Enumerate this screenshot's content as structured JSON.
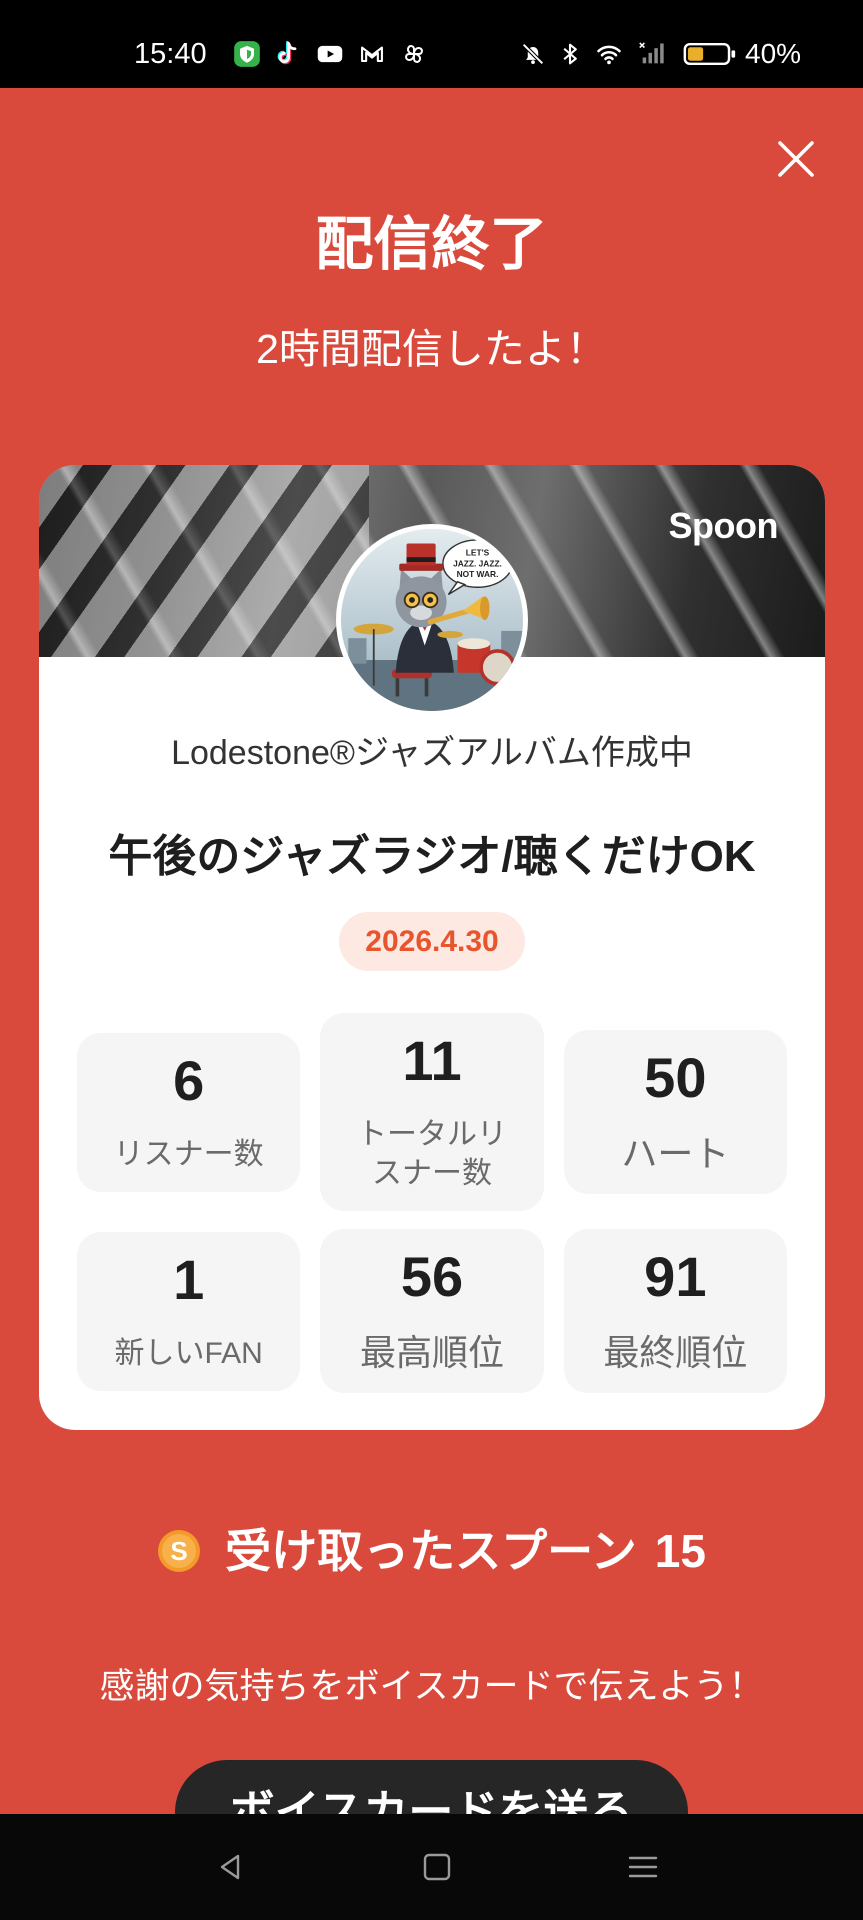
{
  "theme": {
    "background": "#DA4A3C",
    "card": "#FFFFFF",
    "stat_box": "#F5F5F5",
    "date_text": "#E8552D",
    "date_badge": "#FDE8E2",
    "button": "#262626",
    "coin": "#F39A2B",
    "battery": "#E8B02A"
  },
  "status_bar": {
    "time": "15:40",
    "notification_icons": [
      "shield-app-icon",
      "tiktok-icon",
      "youtube-icon",
      "gmail-icon",
      "pinwheel-app-icon"
    ],
    "system_icons": [
      "mute-icon",
      "bluetooth-icon",
      "wifi-icon",
      "signal-icon",
      "battery-icon"
    ],
    "battery_level": 0.4,
    "battery_text": "40%"
  },
  "header": {
    "close_icon": "close-icon",
    "title": "配信終了",
    "subtitle": "2時間配信したよ！"
  },
  "card": {
    "logo_text": "Spoon",
    "avatar_lettering": [
      "LET'S",
      "JAZZ. JAZZ.",
      "NOT WAR."
    ],
    "dj_name": "Lodestone®ジャズアルバム作成中",
    "live_title": "午後のジャズラジオ/聴くだけOK",
    "date": "2026.4.30",
    "stats": [
      {
        "value": 6,
        "label": "リスナー数"
      },
      {
        "value": 11,
        "label": "トータルリスナー数"
      },
      {
        "value": 50,
        "label": "ハート"
      },
      {
        "value": 1,
        "label": "新しいFAN"
      },
      {
        "value": 56,
        "label": "最高順位"
      },
      {
        "value": 91,
        "label": "最終順位"
      }
    ]
  },
  "spoons": {
    "icon": "spoon-coin-icon",
    "coin_letter": "S",
    "label": "受け取ったスプーン",
    "count": "15"
  },
  "voice_card": {
    "message": "感謝の気持ちをボイスカードで伝えよう！",
    "button_label": "ボイスカードを送る"
  },
  "nav_bar": {
    "icons": [
      "back-icon",
      "home-icon",
      "recents-icon"
    ]
  }
}
